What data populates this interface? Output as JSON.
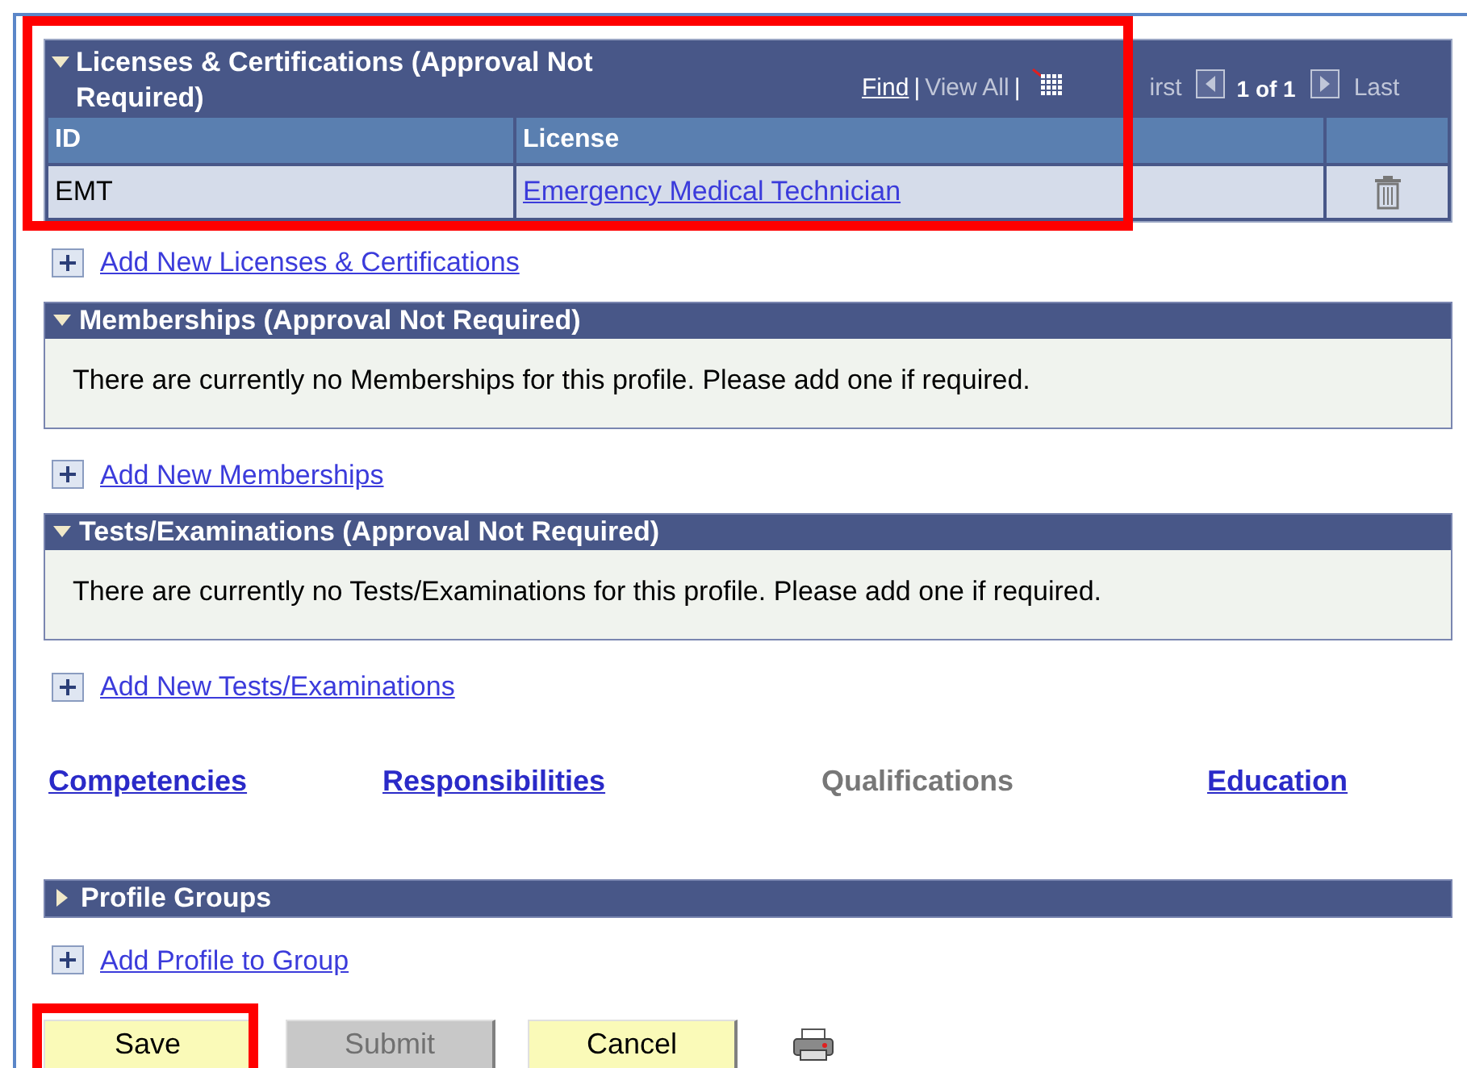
{
  "sections": [
    {
      "kind": "grid",
      "title": "Licenses & Certifications (Approval Not Required)",
      "expanded": true,
      "highlighted": true,
      "nav": {
        "find": "Find",
        "separator_1": "|",
        "view_all": "View All",
        "separator_2": "|",
        "first": "irst",
        "count": "1 of 1",
        "last": "Last"
      },
      "columns": [
        "ID",
        "License"
      ],
      "rows": [
        {
          "id": "EMT",
          "license": "Emergency Medical Technician"
        }
      ],
      "add_link": "Add New Licenses & Certifications"
    },
    {
      "kind": "message",
      "title": "Memberships (Approval Not Required)",
      "expanded": true,
      "highlighted": false,
      "message": "There are currently no Memberships for this profile.  Please add one if required.",
      "add_link": "Add New Memberships"
    },
    {
      "kind": "message",
      "title": "Tests/Examinations (Approval Not Required)",
      "expanded": true,
      "highlighted": false,
      "message": "There are currently no Tests/Examinations for this profile.  Please add one if required.",
      "add_link": "Add New Tests/Examinations"
    }
  ],
  "tabs": [
    {
      "label": "Competencies",
      "selected": false
    },
    {
      "label": "Responsibilities",
      "selected": false
    },
    {
      "label": "Qualifications",
      "selected": true
    },
    {
      "label": "Education",
      "selected": false
    }
  ],
  "profile_groups": {
    "title": "Profile Groups",
    "expanded": false,
    "add_link": "Add Profile to Group"
  },
  "buttons": [
    {
      "label": "Save",
      "disabled": false,
      "highlighted": true
    },
    {
      "label": "Submit",
      "disabled": true,
      "highlighted": false
    },
    {
      "label": "Cancel",
      "disabled": false,
      "highlighted": false
    }
  ]
}
